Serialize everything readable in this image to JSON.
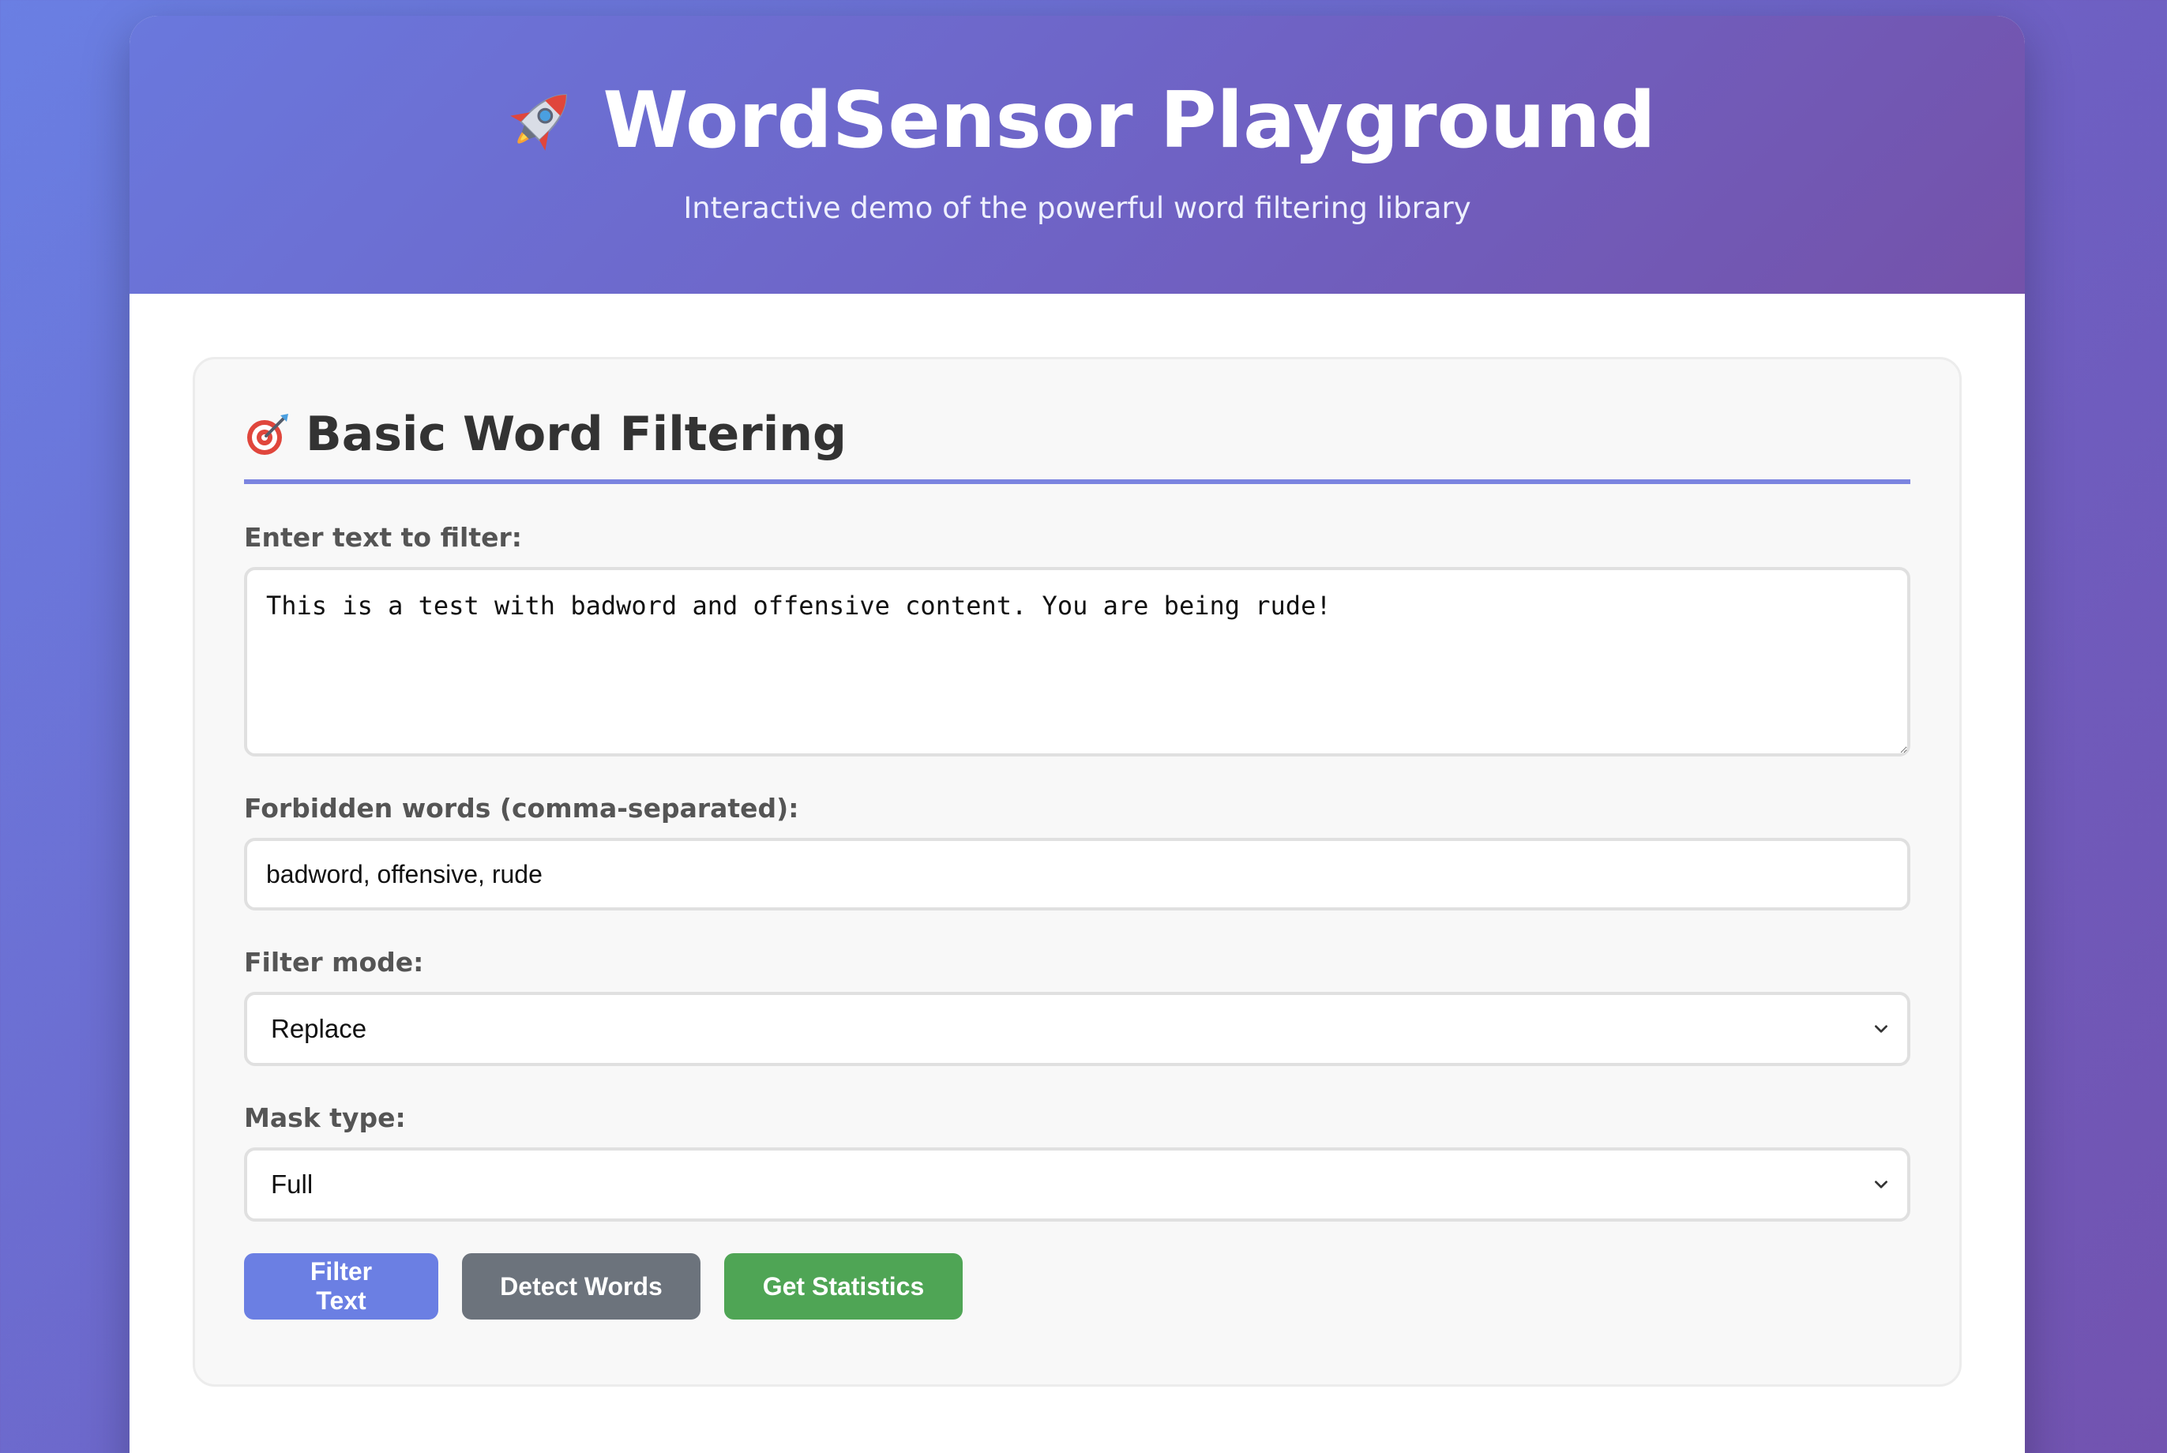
{
  "header": {
    "title": "WordSensor Playground",
    "subtitle": "Interactive demo of the powerful word filtering library",
    "icon": "rocket-icon"
  },
  "section": {
    "title": "Basic Word Filtering",
    "icon": "target-icon",
    "text_label": "Enter text to filter:",
    "text_value": "This is a test with badword and offensive content. You are being rude!",
    "forbidden_label": "Forbidden words (comma-separated):",
    "forbidden_value": "badword, offensive, rude",
    "mode_label": "Filter mode:",
    "mode_value": "Replace",
    "mask_label": "Mask type:",
    "mask_value": "Full"
  },
  "buttons": {
    "filter": "Filter Text",
    "detect": "Detect Words",
    "stats": "Get Statistics"
  },
  "colors": {
    "primary": "#6b7fe3",
    "secondary": "#6c737c",
    "success": "#4fa555",
    "accent_line": "#7b84e0"
  }
}
